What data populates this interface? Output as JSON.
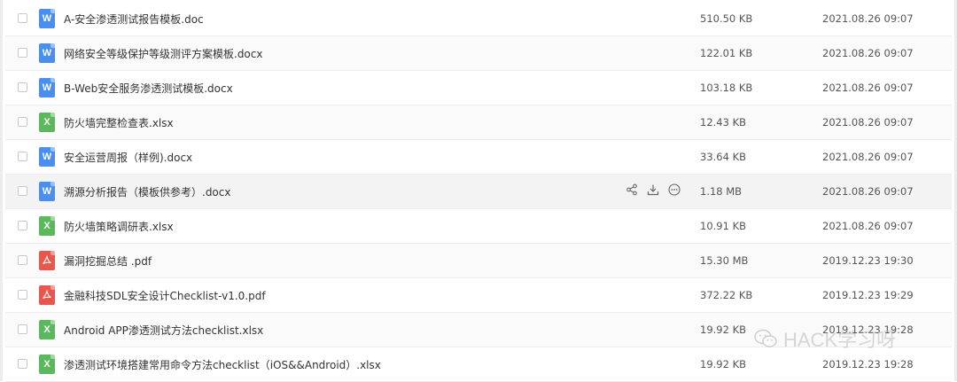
{
  "files": [
    {
      "name": "A-安全渗透测试报告模板.doc",
      "type": "word",
      "size": "510.50 KB",
      "date": "2021.08.26 09:07"
    },
    {
      "name": "网络安全等级保护等级测评方案模板.docx",
      "type": "word",
      "size": "122.01 KB",
      "date": "2021.08.26 09:07"
    },
    {
      "name": "B-Web安全服务渗透测试模板.docx",
      "type": "word",
      "size": "103.18 KB",
      "date": "2021.08.26 09:07"
    },
    {
      "name": "防火墙完整检查表.xlsx",
      "type": "excel",
      "size": "12.43 KB",
      "date": "2021.08.26 09:07"
    },
    {
      "name": "安全运营周报（样例).docx",
      "type": "word",
      "size": "33.64 KB",
      "date": "2021.08.26 09:07"
    },
    {
      "name": "溯源分析报告（模板供参考）.docx",
      "type": "word",
      "size": "1.18 MB",
      "date": "2021.08.26 09:07"
    },
    {
      "name": "防火墙策略调研表.xlsx",
      "type": "excel",
      "size": "10.91 KB",
      "date": "2021.08.26 09:07"
    },
    {
      "name": "漏洞挖掘总结 .pdf",
      "type": "pdf",
      "size": "15.30 MB",
      "date": "2019.12.23 19:30"
    },
    {
      "name": "金融科技SDL安全设计Checklist-v1.0.pdf",
      "type": "pdf",
      "size": "372.22 KB",
      "date": "2019.12.23 19:29"
    },
    {
      "name": "Android APP渗透测试方法checklist.xlsx",
      "type": "excel",
      "size": "19.92 KB",
      "date": "2019.12.23 19:28"
    },
    {
      "name": "渗透测试环境搭建常用命令方法checklist（iOS&&Android）.xlsx",
      "type": "excel",
      "size": "19.92 KB",
      "date": "2019.12.23 19:28"
    }
  ],
  "icon_letters": {
    "word": "W",
    "excel": "X",
    "pdf": ""
  },
  "hover_actions": [
    "share-icon",
    "download-icon",
    "more-icon"
  ],
  "watermark": {
    "text": "HACK学习呀",
    "icon": "wechat-icon"
  },
  "colors": {
    "word": "#4a8ef0",
    "excel": "#5cb85c",
    "pdf": "#e8574e"
  }
}
